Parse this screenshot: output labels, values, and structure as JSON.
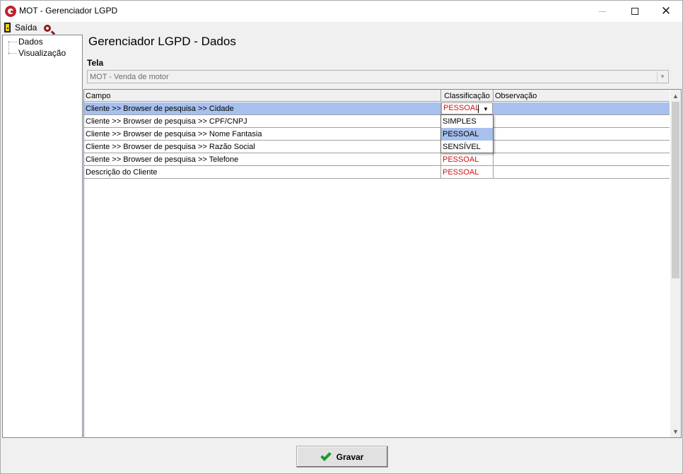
{
  "window": {
    "title": "MOT - Gerenciador LGPD"
  },
  "toolbar": {
    "exit_label": "Saída"
  },
  "tree": {
    "items": [
      "Dados",
      "Visualização"
    ]
  },
  "main": {
    "page_title": "Gerenciador LGPD - Dados",
    "screen_label": "Tela",
    "screen_value": "MOT - Venda de motor"
  },
  "grid": {
    "columns": {
      "campo": "Campo",
      "classificacao": "Classificação",
      "observacao": "Observação"
    },
    "rows": [
      {
        "campo": "Cliente >> Browser de pesquisa >> Cidade",
        "classificacao": "PESSOAL",
        "observacao": ""
      },
      {
        "campo": "Cliente >> Browser de pesquisa >> CPF/CNPJ",
        "classificacao": "",
        "observacao": ""
      },
      {
        "campo": "Cliente >> Browser de pesquisa >> Nome Fantasia",
        "classificacao": "",
        "observacao": ""
      },
      {
        "campo": "Cliente >> Browser de pesquisa >> Razão Social",
        "classificacao": "",
        "observacao": ""
      },
      {
        "campo": "Cliente >> Browser de pesquisa >> Telefone",
        "classificacao": "PESSOAL",
        "observacao": ""
      },
      {
        "campo": "Descrição do Cliente",
        "classificacao": "PESSOAL",
        "observacao": ""
      }
    ],
    "dropdown_options": [
      "SIMPLES",
      "PESSOAL",
      "SENSÍVEL"
    ],
    "dropdown_highlighted": "PESSOAL"
  },
  "footer": {
    "save_label": "Gravar"
  },
  "colors": {
    "accent_red": "#cc1111",
    "selection": "#a8c0ee",
    "check_green": "#1e9a2c",
    "logo_red": "#c4202a"
  },
  "icons": [
    "app-logo-icon",
    "exit-door-icon",
    "search-icon",
    "checkmark-icon",
    "chevron-down-icon"
  ]
}
